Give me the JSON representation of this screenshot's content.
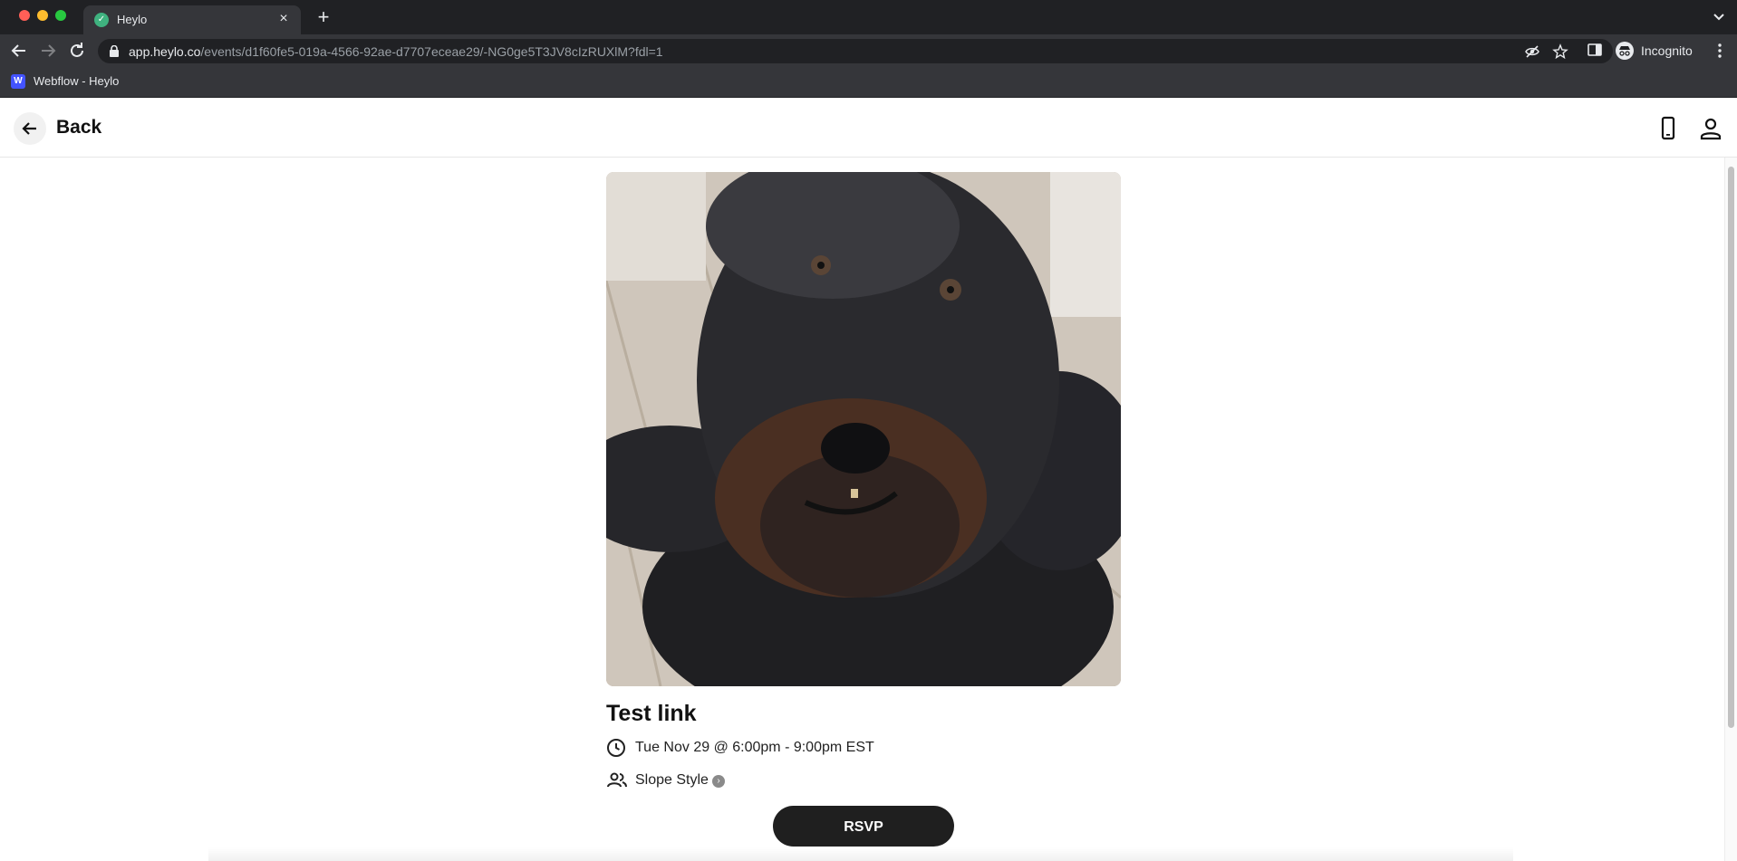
{
  "browser": {
    "tab": {
      "title": "Heylo"
    },
    "url": {
      "host": "app.heylo.co",
      "path": "/events/d1f60fe5-019a-4566-92ae-d7707eceae29/-NG0ge5T3JV8cIzRUXlM?fdl=1"
    },
    "profile_label": "Incognito",
    "bookmarks": [
      {
        "label": "Webflow - Heylo"
      }
    ]
  },
  "header": {
    "back_label": "Back"
  },
  "event": {
    "title": "Test link",
    "datetime": "Tue Nov 29 @ 6:00pm - 9:00pm EST",
    "group": "Slope Style",
    "rsvp_label": "RSVP"
  }
}
